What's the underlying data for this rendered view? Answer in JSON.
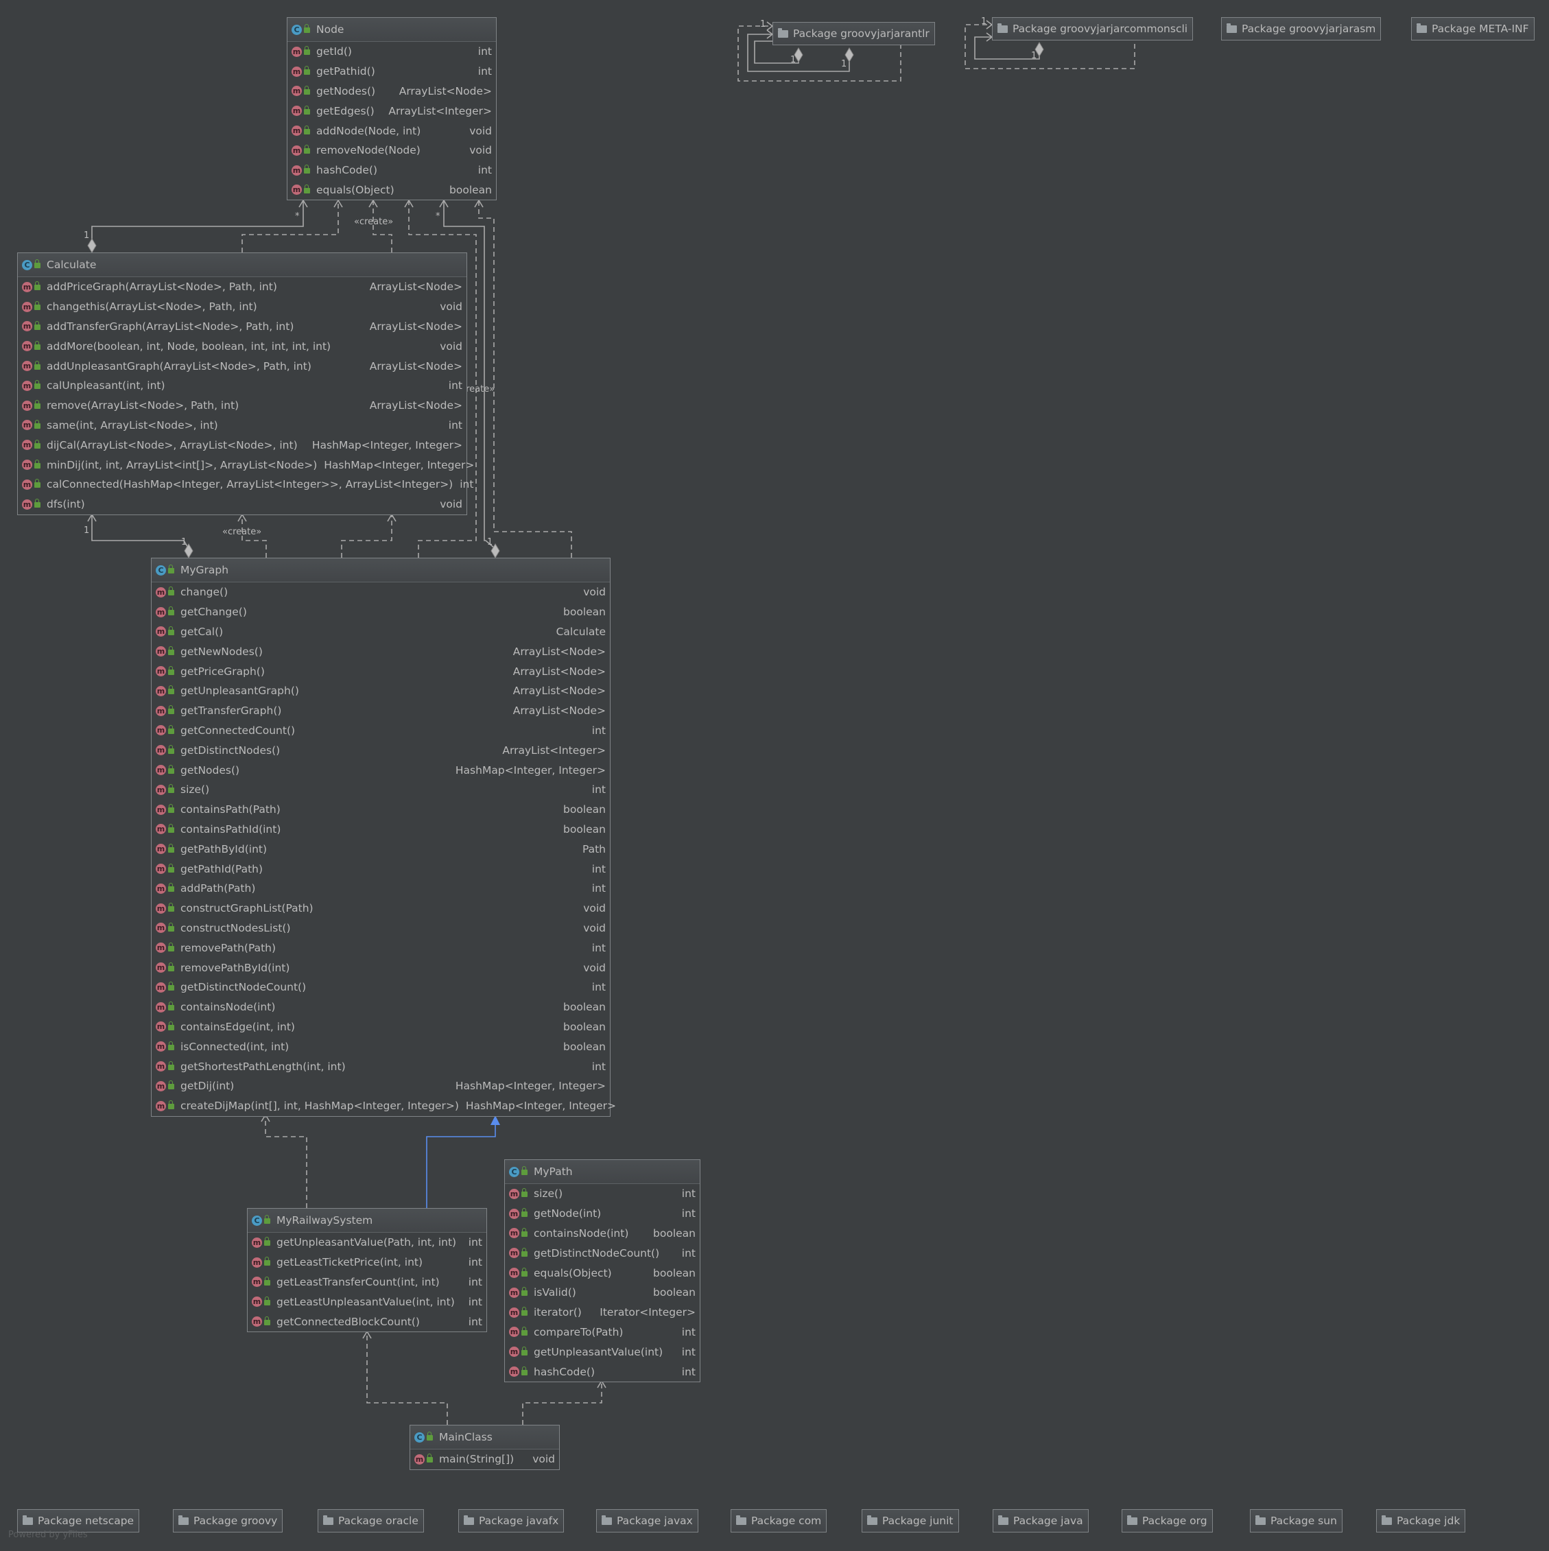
{
  "classes": {
    "node": {
      "name": "Node",
      "methods": [
        {
          "name": "getId()",
          "type": "int"
        },
        {
          "name": "getPathid()",
          "type": "int"
        },
        {
          "name": "getNodes()",
          "type": "ArrayList<Node>"
        },
        {
          "name": "getEdges()",
          "type": "ArrayList<Integer>"
        },
        {
          "name": "addNode(Node, int)",
          "type": "void"
        },
        {
          "name": "removeNode(Node)",
          "type": "void"
        },
        {
          "name": "hashCode()",
          "type": "int"
        },
        {
          "name": "equals(Object)",
          "type": "boolean"
        }
      ]
    },
    "calculate": {
      "name": "Calculate",
      "methods": [
        {
          "name": "addPriceGraph(ArrayList<Node>, Path, int)",
          "type": "ArrayList<Node>"
        },
        {
          "name": "changethis(ArrayList<Node>, Path, int)",
          "type": "void"
        },
        {
          "name": "addTransferGraph(ArrayList<Node>, Path, int)",
          "type": "ArrayList<Node>"
        },
        {
          "name": "addMore(boolean, int, Node, boolean, int, int, int, int)",
          "type": "void"
        },
        {
          "name": "addUnpleasantGraph(ArrayList<Node>, Path, int)",
          "type": "ArrayList<Node>"
        },
        {
          "name": "calUnpleasant(int, int)",
          "type": "int"
        },
        {
          "name": "remove(ArrayList<Node>, Path, int)",
          "type": "ArrayList<Node>"
        },
        {
          "name": "same(int, ArrayList<Node>, int)",
          "type": "int"
        },
        {
          "name": "dijCal(ArrayList<Node>, ArrayList<Node>, int)",
          "type": "HashMap<Integer, Integer>"
        },
        {
          "name": "minDij(int, int, ArrayList<int[]>, ArrayList<Node>)",
          "type": "HashMap<Integer, Integer>"
        },
        {
          "name": "calConnected(HashMap<Integer, ArrayList<Integer>>, ArrayList<Integer>)",
          "type": "int"
        },
        {
          "name": "dfs(int)",
          "type": "void"
        }
      ]
    },
    "mygraph": {
      "name": "MyGraph",
      "methods": [
        {
          "name": "change()",
          "type": "void"
        },
        {
          "name": "getChange()",
          "type": "boolean"
        },
        {
          "name": "getCal()",
          "type": "Calculate"
        },
        {
          "name": "getNewNodes()",
          "type": "ArrayList<Node>"
        },
        {
          "name": "getPriceGraph()",
          "type": "ArrayList<Node>"
        },
        {
          "name": "getUnpleasantGraph()",
          "type": "ArrayList<Node>"
        },
        {
          "name": "getTransferGraph()",
          "type": "ArrayList<Node>"
        },
        {
          "name": "getConnectedCount()",
          "type": "int"
        },
        {
          "name": "getDistinctNodes()",
          "type": "ArrayList<Integer>"
        },
        {
          "name": "getNodes()",
          "type": "HashMap<Integer, Integer>"
        },
        {
          "name": "size()",
          "type": "int"
        },
        {
          "name": "containsPath(Path)",
          "type": "boolean"
        },
        {
          "name": "containsPathId(int)",
          "type": "boolean"
        },
        {
          "name": "getPathById(int)",
          "type": "Path"
        },
        {
          "name": "getPathId(Path)",
          "type": "int"
        },
        {
          "name": "addPath(Path)",
          "type": "int"
        },
        {
          "name": "constructGraphList(Path)",
          "type": "void"
        },
        {
          "name": "constructNodesList()",
          "type": "void"
        },
        {
          "name": "removePath(Path)",
          "type": "int"
        },
        {
          "name": "removePathById(int)",
          "type": "void"
        },
        {
          "name": "getDistinctNodeCount()",
          "type": "int"
        },
        {
          "name": "containsNode(int)",
          "type": "boolean"
        },
        {
          "name": "containsEdge(int, int)",
          "type": "boolean"
        },
        {
          "name": "isConnected(int, int)",
          "type": "boolean"
        },
        {
          "name": "getShortestPathLength(int, int)",
          "type": "int"
        },
        {
          "name": "getDij(int)",
          "type": "HashMap<Integer, Integer>"
        },
        {
          "name": "createDijMap(int[], int, HashMap<Integer, Integer>)",
          "type": "HashMap<Integer, Integer>"
        }
      ]
    },
    "myrailwaysystem": {
      "name": "MyRailwaySystem",
      "methods": [
        {
          "name": "getUnpleasantValue(Path, int, int)",
          "type": "int"
        },
        {
          "name": "getLeastTicketPrice(int, int)",
          "type": "int"
        },
        {
          "name": "getLeastTransferCount(int, int)",
          "type": "int"
        },
        {
          "name": "getLeastUnpleasantValue(int, int)",
          "type": "int"
        },
        {
          "name": "getConnectedBlockCount()",
          "type": "int"
        }
      ]
    },
    "mypath": {
      "name": "MyPath",
      "methods": [
        {
          "name": "size()",
          "type": "int"
        },
        {
          "name": "getNode(int)",
          "type": "int"
        },
        {
          "name": "containsNode(int)",
          "type": "boolean"
        },
        {
          "name": "getDistinctNodeCount()",
          "type": "int"
        },
        {
          "name": "equals(Object)",
          "type": "boolean"
        },
        {
          "name": "isValid()",
          "type": "boolean"
        },
        {
          "name": "iterator()",
          "type": "Iterator<Integer>"
        },
        {
          "name": "compareTo(Path)",
          "type": "int"
        },
        {
          "name": "getUnpleasantValue(int)",
          "type": "int"
        },
        {
          "name": "hashCode()",
          "type": "int"
        }
      ]
    },
    "mainclass": {
      "name": "MainClass",
      "methods": [
        {
          "name": "main(String[])",
          "type": "void"
        }
      ]
    }
  },
  "packages_top": [
    "Package groovyjarjarantlr",
    "Package groovyjarjarcommonscli",
    "Package groovyjarjarasm",
    "Package META-INF"
  ],
  "packages_bottom": [
    "Package netscape",
    "Package groovy",
    "Package oracle",
    "Package javafx",
    "Package javax",
    "Package com",
    "Package junit",
    "Package java",
    "Package org",
    "Package sun",
    "Package jdk"
  ],
  "labels": {
    "create": "«create»",
    "many": "*",
    "one": "1"
  },
  "icons": {
    "class": "C",
    "method": "m"
  },
  "credit": "Powered by yFiles",
  "colors": {
    "background": "#3c3f41",
    "border": "#7f8386",
    "edge": "#aaaaaa",
    "inheritance": "#5a8dee",
    "class_icon": "#4a9bc4",
    "method_icon": "#c06a78",
    "lock_icon": "#5e9c3d"
  }
}
